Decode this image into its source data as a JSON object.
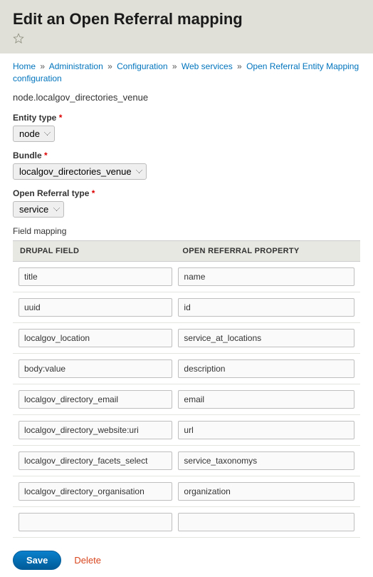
{
  "header": {
    "title": "Edit an Open Referral mapping"
  },
  "breadcrumb": {
    "home": "Home",
    "administration": "Administration",
    "configuration": "Configuration",
    "web_services": "Web services",
    "current": "Open Referral Entity Mapping configuration"
  },
  "machine_name": "node.localgov_directories_venue",
  "labels": {
    "entity_type": "Entity type",
    "bundle": "Bundle",
    "open_referral_type": "Open Referral type",
    "field_mapping": "Field mapping"
  },
  "selects": {
    "entity_type": "node",
    "bundle": "localgov_directories_venue",
    "open_referral_type": "service"
  },
  "table": {
    "col1": "DRUPAL FIELD",
    "col2": "OPEN REFERRAL PROPERTY",
    "rows": [
      {
        "field": "title",
        "property": "name"
      },
      {
        "field": "uuid",
        "property": "id"
      },
      {
        "field": "localgov_location",
        "property": "service_at_locations"
      },
      {
        "field": "body:value",
        "property": "description"
      },
      {
        "field": "localgov_directory_email",
        "property": "email"
      },
      {
        "field": "localgov_directory_website:uri",
        "property": "url"
      },
      {
        "field": "localgov_directory_facets_select",
        "property": "service_taxonomys"
      },
      {
        "field": "localgov_directory_organisation",
        "property": "organization"
      },
      {
        "field": "",
        "property": ""
      }
    ]
  },
  "actions": {
    "save": "Save",
    "delete": "Delete"
  }
}
